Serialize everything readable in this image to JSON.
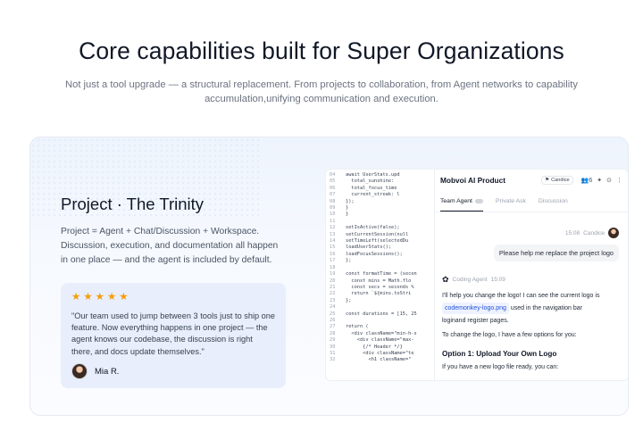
{
  "hero": {
    "title": "Core capabilities built for Super Organizations",
    "subtitle": "Not just a tool upgrade — a structural replacement. From projects to collaboration, from Agent networks to capability accumulation,unifying communication and execution."
  },
  "feature": {
    "title": "Project · The Trinity",
    "description": "Project = Agent + Chat/Discussion + Workspace. Discussion, execution, and documentation all happen in one place — and the agent is included by default.",
    "testimonial": {
      "rating": 5,
      "quote": "\"Our team used to jump between 3 tools just to ship one feature. Now everything happens in one project — the agent knows our codebase, the discussion is right there, and docs update themselves.\"",
      "author": "Mia R."
    }
  },
  "code_lines": [
    [
      "04",
      "await UserStats.upd"
    ],
    [
      "05",
      "  total_sunshine:"
    ],
    [
      "06",
      "  total_focus_time"
    ],
    [
      "07",
      "  current_streak: l"
    ],
    [
      "08",
      "});"
    ],
    [
      "09",
      "}"
    ],
    [
      "10",
      "}"
    ],
    [
      "11",
      ""
    ],
    [
      "12",
      "setIsActive(false);"
    ],
    [
      "13",
      "setCurrentSession(null"
    ],
    [
      "14",
      "setTimeLeft(selectedDu"
    ],
    [
      "15",
      "loadUserStats();"
    ],
    [
      "16",
      "loadFocusSessions();"
    ],
    [
      "17",
      "};"
    ],
    [
      "18",
      ""
    ],
    [
      "19",
      "const formatTime = (secon"
    ],
    [
      "20",
      "  const mins = Math.flo"
    ],
    [
      "21",
      "  const secs = seconds %"
    ],
    [
      "22",
      "  return `${mins.toStri"
    ],
    [
      "23",
      "};"
    ],
    [
      "24",
      ""
    ],
    [
      "25",
      "const durations = [15, 25"
    ],
    [
      "26",
      ""
    ],
    [
      "27",
      "return ("
    ],
    [
      "28",
      "  <div className=\"min-h-s"
    ],
    [
      "29",
      "    <div className=\"max-"
    ],
    [
      "30",
      "      {/* Header */}"
    ],
    [
      "31",
      "      <div className=\"te"
    ],
    [
      "32",
      "        <h1 className=\""
    ]
  ],
  "chat": {
    "title": "Mobvoi AI Product",
    "member_chip": "Candice",
    "member_count": "6",
    "tabs": [
      "Team Agent",
      "Private Ask",
      "Discussion"
    ],
    "user_time": "15:08",
    "user_name": "Candice",
    "user_message": "Please help me replace the project logo",
    "agent_name": "Coding Agent",
    "agent_time": "15:09",
    "reply_intro_1": "I'll help you change the logo! I can see the current logo is",
    "file_name": "codemonkey-logo.png",
    "reply_intro_2": "used in the navigation bar",
    "reply_intro_3": "loginand register pages.",
    "reply_options": "To change the logo, I have a few options for you:",
    "option_title": "Option 1: Upload Your Own Logo",
    "option_text": "If you have a new logo file ready, you can:"
  }
}
